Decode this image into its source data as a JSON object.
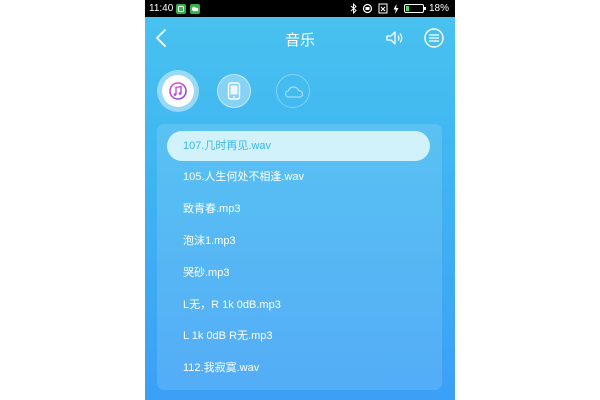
{
  "status_bar": {
    "time": "11:40",
    "battery_percent": "18%",
    "battery_level": 0.18
  },
  "header": {
    "title": "音乐"
  },
  "source_tabs": [
    {
      "icon": "music-note-icon",
      "selected": true
    },
    {
      "icon": "phone-device-icon",
      "selected": false
    },
    {
      "icon": "cloud-icon",
      "selected": false
    }
  ],
  "tracks": [
    {
      "label": "107.几时再见.wav",
      "active": true
    },
    {
      "label": "105.人生何处不相逢.wav",
      "active": false
    },
    {
      "label": "致青春.mp3",
      "active": false
    },
    {
      "label": "泡沫1.mp3",
      "active": false
    },
    {
      "label": "哭砂.mp3",
      "active": false
    },
    {
      "label": "L无，R 1k 0dB.mp3",
      "active": false
    },
    {
      "label": "L 1k 0dB R无.mp3",
      "active": false
    },
    {
      "label": "112.我寂寞.wav",
      "active": false
    }
  ],
  "colors": {
    "active_track_bg": "#d2f2fb",
    "active_track_text": "#38b8ea",
    "background_top": "#49c3ef",
    "background_bottom": "#3ba0f6"
  }
}
